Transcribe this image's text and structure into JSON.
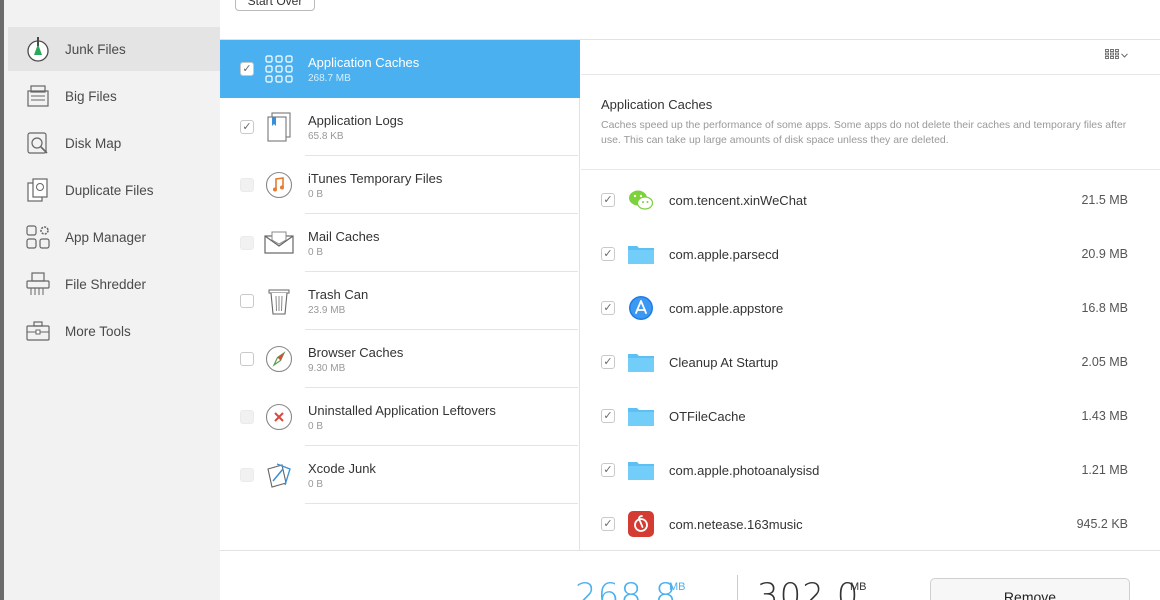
{
  "toolbar": {
    "start_over_label": "Start Over"
  },
  "sidebar": {
    "items": [
      {
        "label": "Junk Files",
        "icon": "broom-icon",
        "active": true
      },
      {
        "label": "Big Files",
        "icon": "big-files-icon"
      },
      {
        "label": "Disk Map",
        "icon": "disk-map-icon"
      },
      {
        "label": "Duplicate Files",
        "icon": "duplicate-files-icon"
      },
      {
        "label": "App Manager",
        "icon": "app-manager-icon"
      },
      {
        "label": "File Shredder",
        "icon": "shredder-icon"
      },
      {
        "label": "More Tools",
        "icon": "toolbox-icon"
      }
    ]
  },
  "categories": [
    {
      "name": "Application Caches",
      "size": "268.7 MB",
      "checked": true,
      "selected": true,
      "icon": "app-grid-icon"
    },
    {
      "name": "Application Logs",
      "size": "65.8 KB",
      "checked": true,
      "icon": "log-document-icon"
    },
    {
      "name": "iTunes Temporary Files",
      "size": "0 B",
      "checked": false,
      "disabled": true,
      "icon": "music-note-icon"
    },
    {
      "name": "Mail Caches",
      "size": "0 B",
      "checked": false,
      "disabled": true,
      "icon": "mail-envelope-icon"
    },
    {
      "name": "Trash Can",
      "size": "23.9 MB",
      "checked": false,
      "icon": "trash-can-icon"
    },
    {
      "name": "Browser Caches",
      "size": "9.30 MB",
      "checked": false,
      "icon": "compass-icon"
    },
    {
      "name": "Uninstalled Application Leftovers",
      "size": "0 B",
      "checked": false,
      "disabled": true,
      "icon": "x-circle-icon"
    },
    {
      "name": "Xcode Junk",
      "size": "0 B",
      "checked": false,
      "disabled": true,
      "icon": "xcode-icon"
    }
  ],
  "detail": {
    "title": "Application Caches",
    "description": "Caches speed up the performance of some apps. Some apps do not delete their caches and temporary files after use. This can take up large amounts of disk space unless they are deleted.",
    "view_toggle_icon": "grid-view-icon",
    "apps": [
      {
        "name": "com.tencent.xinWeChat",
        "size": "21.5 MB",
        "icon": "wechat-icon",
        "checked": true
      },
      {
        "name": "com.apple.parsecd",
        "size": "20.9 MB",
        "icon": "folder-icon",
        "checked": true
      },
      {
        "name": "com.apple.appstore",
        "size": "16.8 MB",
        "icon": "app-store-icon",
        "checked": true
      },
      {
        "name": "Cleanup At Startup",
        "size": "2.05 MB",
        "icon": "folder-icon",
        "checked": true
      },
      {
        "name": "OTFileCache",
        "size": "1.43 MB",
        "icon": "folder-icon",
        "checked": true
      },
      {
        "name": "com.apple.photoanalysisd",
        "size": "1.21 MB",
        "icon": "folder-icon",
        "checked": true
      },
      {
        "name": "com.netease.163music",
        "size": "945.2 KB",
        "icon": "netease-music-icon",
        "checked": true
      }
    ]
  },
  "summary": {
    "selected_size": "268.8",
    "selected_unit": "MB",
    "total_size": "302.0",
    "total_unit": "MB",
    "remove_label": "Remove"
  },
  "colors": {
    "accent": "#4ab0ef",
    "folder": "#5cc0f5",
    "wechat": "#7bd23b",
    "netease": "#d43c33"
  }
}
